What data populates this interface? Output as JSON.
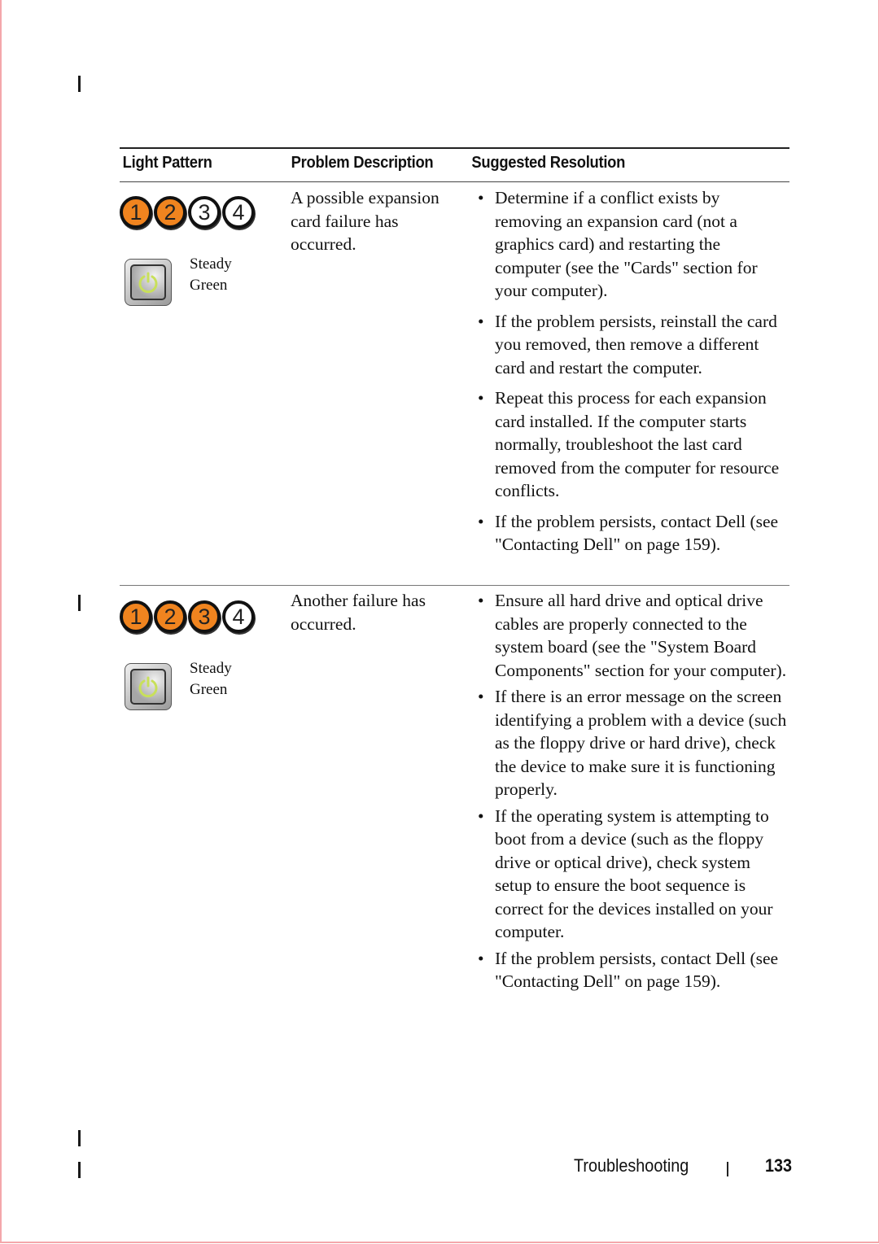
{
  "table": {
    "headers": {
      "light_pattern": "Light Pattern",
      "problem_description": "Problem Description",
      "suggested_resolution": "Suggested Resolution"
    },
    "rows": [
      {
        "leds": [
          {
            "label": "1",
            "state": "on"
          },
          {
            "label": "2",
            "state": "on"
          },
          {
            "label": "3",
            "state": "off"
          },
          {
            "label": "4",
            "state": "off"
          }
        ],
        "power_light": {
          "state_line1": "Steady",
          "state_line2": "Green",
          "icon": "power-icon",
          "color": "#c8e05a"
        },
        "problem": "A possible expansion card failure has occurred.",
        "resolutions": [
          "Determine if a conflict exists by removing an expansion card (not a graphics card) and restarting the computer (see the \"Cards\" section for your computer).",
          "If the problem persists, reinstall the card you removed, then remove a different card and restart the computer.",
          "Repeat this process for each expansion card installed. If the computer starts normally, troubleshoot the last card removed from the computer for resource conflicts.",
          "If the problem persists, contact Dell (see \"Contacting Dell\" on page 159)."
        ]
      },
      {
        "leds": [
          {
            "label": "1",
            "state": "on"
          },
          {
            "label": "2",
            "state": "on"
          },
          {
            "label": "3",
            "state": "on"
          },
          {
            "label": "4",
            "state": "off"
          }
        ],
        "power_light": {
          "state_line1": "Steady",
          "state_line2": "Green",
          "icon": "power-icon",
          "color": "#c8e05a"
        },
        "problem": "Another failure has occurred.",
        "resolutions": [
          "Ensure all hard drive and optical drive cables are properly connected to the system board (see the \"System Board Components\" section for your computer).",
          "If there is an error message on the screen identifying a problem with a device (such as the floppy drive or hard drive), check the device to make sure it is functioning properly.",
          "If the operating system is attempting to boot from a device (such as the floppy drive or optical drive), check system setup to ensure the boot sequence is correct for the devices installed on your computer.",
          "If the problem persists, contact Dell (see \"Contacting Dell\" on page 159)."
        ]
      }
    ]
  },
  "footer": {
    "section": "Troubleshooting",
    "page_number": "133"
  },
  "colors": {
    "led_on": "#f0841f",
    "led_off": "#ffffff",
    "page_border": "#f4a7ab"
  }
}
